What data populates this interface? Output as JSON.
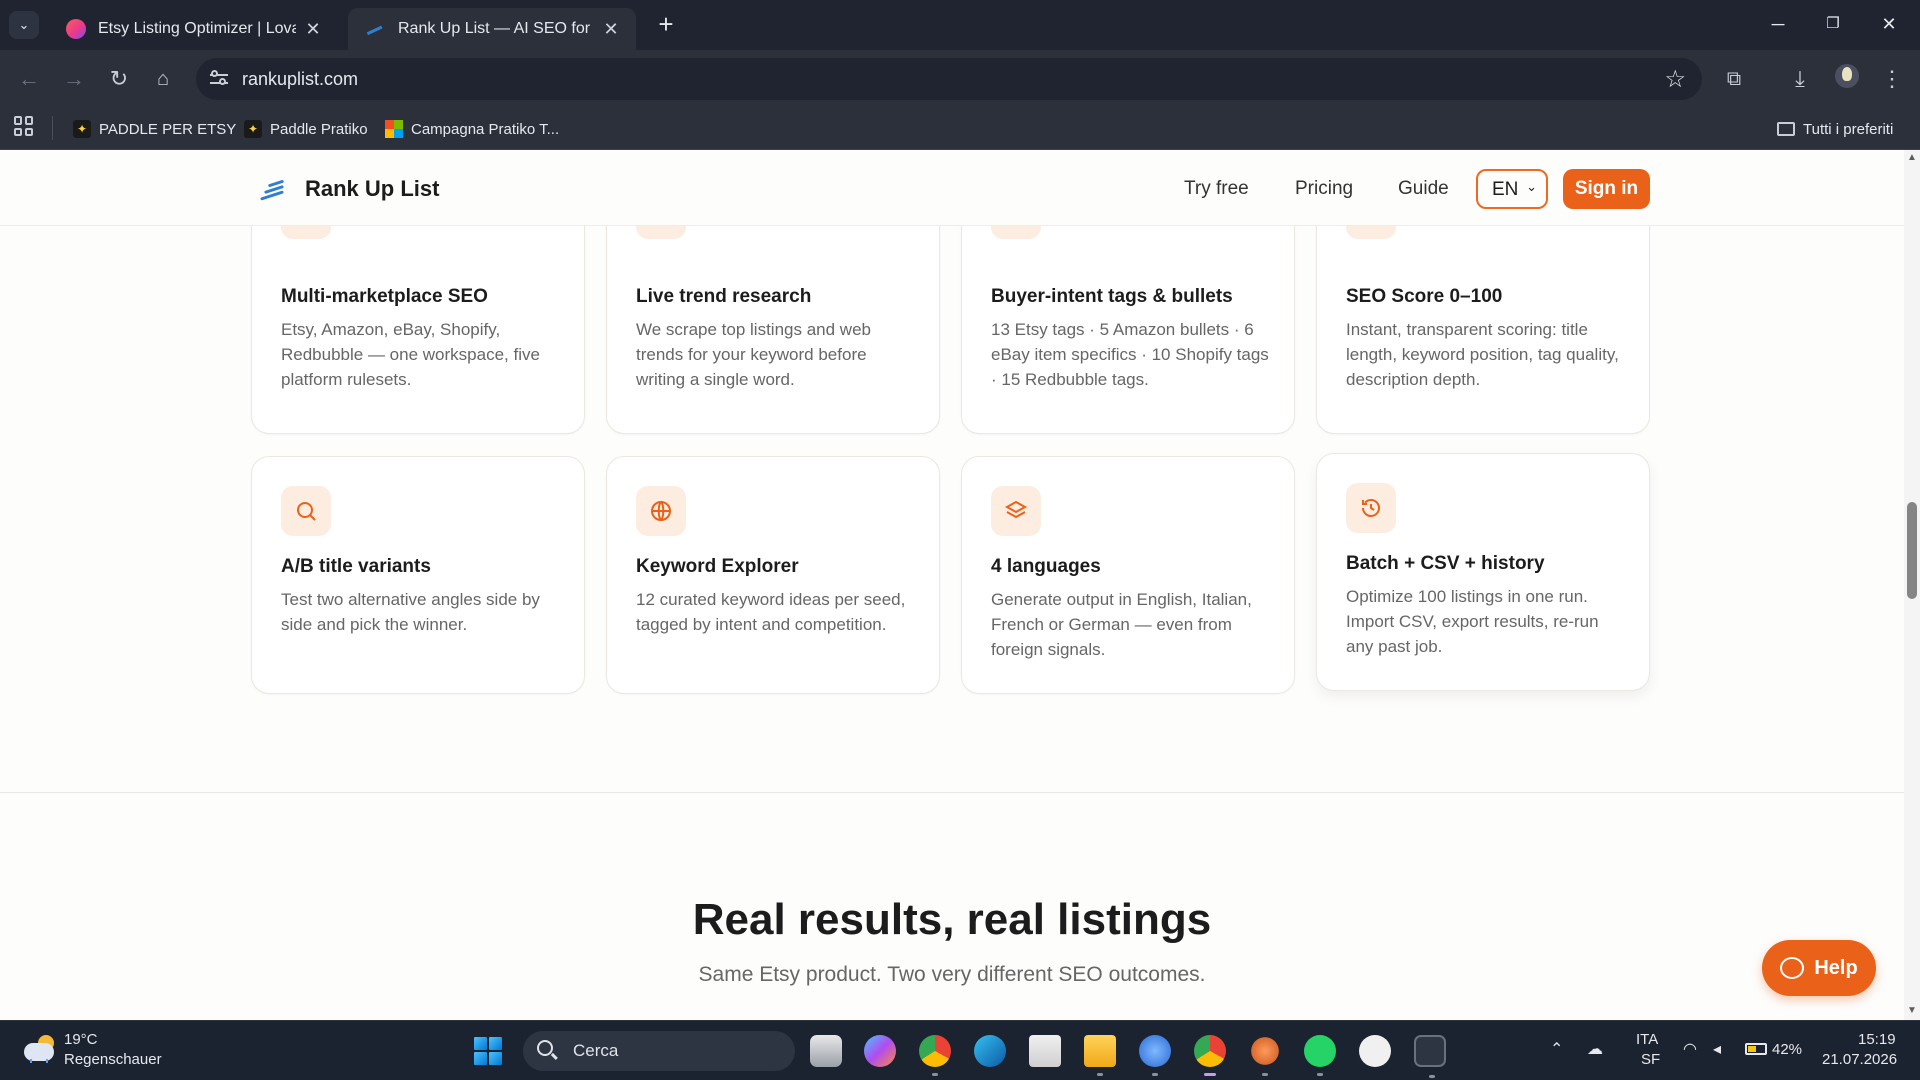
{
  "browser": {
    "tabs": [
      {
        "title": "Etsy Listing Optimizer | Lovable",
        "active": false
      },
      {
        "title": "Rank Up List — AI SEO for Etsy,",
        "active": true
      }
    ],
    "url": "rankuplist.com",
    "bookmarks": [
      "PADDLE PER ETSY",
      "Paddle Pratiko",
      "Campagna Pratiko T..."
    ],
    "all_bookmarks": "Tutti i preferiti"
  },
  "site": {
    "brand": "Rank Up List",
    "nav": {
      "try_free": "Try free",
      "pricing": "Pricing",
      "guide": "Guide",
      "language": "EN",
      "sign_in": "Sign in"
    },
    "features": [
      {
        "icon": "trending-icon",
        "title": "Multi-marketplace SEO",
        "desc": "Etsy, Amazon, eBay, Shopify, Redbubble — one workspace, five platform rulesets."
      },
      {
        "icon": "heart-icon",
        "title": "Live trend research",
        "desc": "We scrape top listings and web trends for your keyword before writing a single word."
      },
      {
        "icon": "code-icon",
        "title": "Buyer-intent tags & bullets",
        "desc": "13 Etsy tags · 5 Amazon bullets · 6 eBay item specifics · 10 Shopify tags · 15 Redbubble tags."
      },
      {
        "icon": "book-icon",
        "title": "SEO Score 0–100",
        "desc": "Instant, transparent scoring: title length, keyword position, tag quality, description depth."
      },
      {
        "icon": "search-icon",
        "title": "A/B title variants",
        "desc": "Test two alternative angles side by side and pick the winner."
      },
      {
        "icon": "globe-icon",
        "title": "Keyword Explorer",
        "desc": "12 curated keyword ideas per seed, tagged by intent and competition."
      },
      {
        "icon": "layers-icon",
        "title": "4 languages",
        "desc": "Generate output in English, Italian, French or German — even from foreign signals."
      },
      {
        "icon": "history-icon",
        "title": "Batch + CSV + history",
        "desc": "Optimize 100 listings in one run. Import CSV, export results, re-run any past job."
      }
    ],
    "results_title": "Real results, real listings",
    "results_subtitle": "Same Etsy product. Two very different SEO outcomes.",
    "help_label": "Help"
  },
  "taskbar": {
    "weather_temp": "19°C",
    "weather_desc": "Regenschauer",
    "search_placeholder": "Cerca",
    "lang_line1": "ITA",
    "lang_line2": "SF",
    "battery": "42%",
    "time": "15:19",
    "date": "21.07.2026"
  },
  "colors": {
    "accent": "#ea6219",
    "icon_bg": "#fdece0",
    "chrome_dark": "#1f2430",
    "taskbar": "#1c2330"
  }
}
